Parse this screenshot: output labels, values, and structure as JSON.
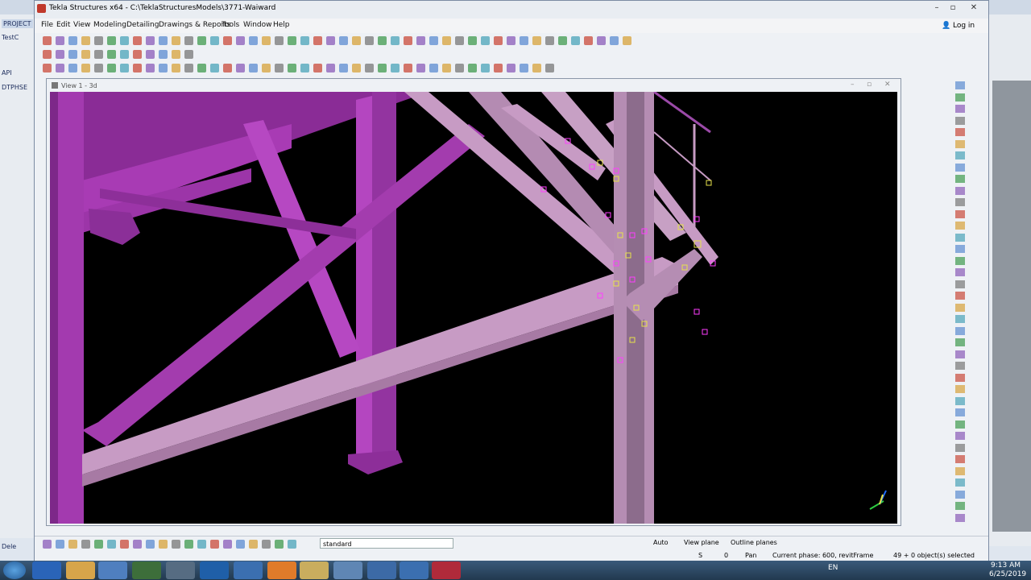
{
  "window": {
    "title": "Tekla Structures x64 - C:\\TeklaStructuresModels\\3771-Waiward",
    "login": "Log in"
  },
  "menus": [
    "File",
    "Edit",
    "View",
    "Modeling",
    "Detailing",
    "Drawings & Reports",
    "Tools",
    "Window",
    "Help"
  ],
  "background": {
    "tab": "PROJECT",
    "left_labels": [
      "TestC",
      "DTPHSE",
      "API"
    ],
    "del_label": "Dele"
  },
  "view": {
    "title": "View 1 - 3d"
  },
  "bottom": {
    "select_value": "standard",
    "auto": "Auto",
    "view_plane": "View plane",
    "outline_planes": "Outline planes"
  },
  "status": {
    "s": "S",
    "zero": "0",
    "pan": "Pan",
    "phase": "Current phase: 600, revitFrame",
    "selected": "49 + 0 object(s) selected"
  },
  "taskbar": {
    "lang": "EN",
    "time": "9:13 AM",
    "date": "6/25/2019"
  },
  "colors": {
    "steel_magenta": "#9b2fa8",
    "steel_pink": "#b98fb6",
    "canvas_bg": "#000000",
    "taskbar": "#2b4563",
    "bolt_yellow": "#e6e24a"
  }
}
